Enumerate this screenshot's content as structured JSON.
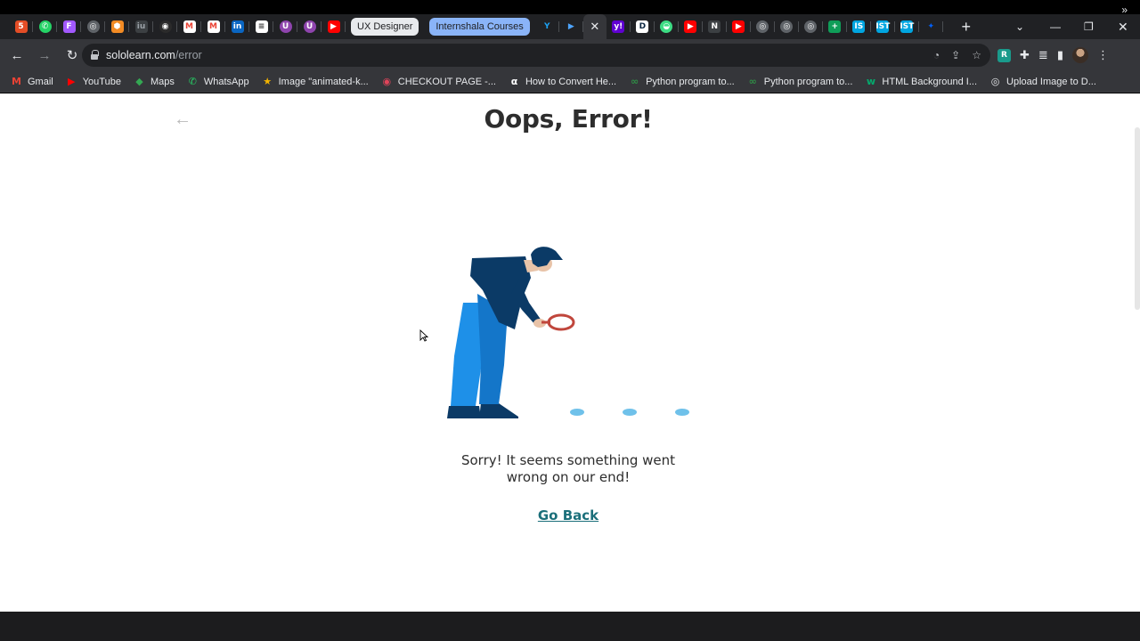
{
  "browser": {
    "tab_groups": [
      {
        "label": "UX Designer",
        "color": "#e8eaed"
      },
      {
        "label": "Internshala Courses",
        "color": "#8ab4f8"
      }
    ],
    "address": {
      "host": "sololearn.com",
      "path": "/error"
    },
    "bookmarks": [
      {
        "label": "Gmail",
        "icon": "gmail-icon",
        "color": "#ea4335"
      },
      {
        "label": "YouTube",
        "icon": "youtube-icon",
        "color": "#ff0000"
      },
      {
        "label": "Maps",
        "icon": "maps-icon",
        "color": "#34a853"
      },
      {
        "label": "WhatsApp",
        "icon": "whatsapp-icon",
        "color": "#25d366"
      },
      {
        "label": "Image \"animated-k...",
        "icon": "star-icon",
        "color": "#f4b400"
      },
      {
        "label": "CHECKOUT PAGE -...",
        "icon": "lips-icon",
        "color": "#e0445a"
      },
      {
        "label": "How to Convert He...",
        "icon": "alpha-icon",
        "color": "#ffffff"
      },
      {
        "label": "Python program to...",
        "icon": "gfg-icon",
        "color": "#2f8d46"
      },
      {
        "label": "Python program to...",
        "icon": "gfg-icon",
        "color": "#2f8d46"
      },
      {
        "label": "HTML Background I...",
        "icon": "w-icon",
        "color": "#04aa6d"
      },
      {
        "label": "Upload Image to D...",
        "icon": "globe-icon",
        "color": "#e8eaed"
      }
    ]
  },
  "page": {
    "title": "Oops, Error!",
    "message_line1": "Sorry! It seems something went",
    "message_line2": "wrong on our end!",
    "go_back": "Go Back"
  },
  "colors": {
    "link": "#1b6f7a",
    "figure_dark": "#0b3a66",
    "figure_light": "#1e90e8",
    "lens": "#c0463c",
    "footprint": "#6fc1ea"
  }
}
